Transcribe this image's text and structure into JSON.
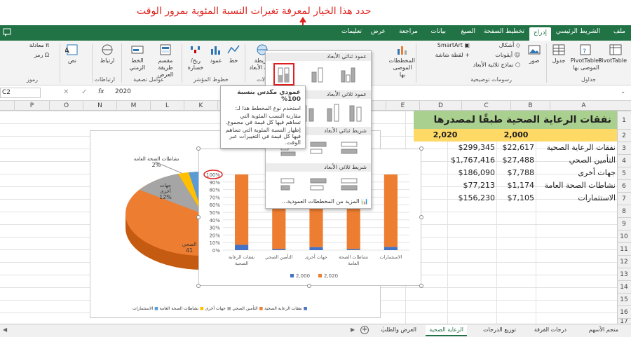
{
  "annotation": "حدد هذا الخيار لمعرفة تغيرات النسبة المئوية بمرور الوقت",
  "tabs": [
    "ملف",
    "الشريط الرئيسي",
    "إدراج",
    "تخطيط الصفحة",
    "الصيغ",
    "بيانات",
    "مراجعة",
    "عرض",
    "تعليمات"
  ],
  "active_tab": "إدراج",
  "ribbon": {
    "pivottable": "PivotTable",
    "recommended_pivot": "PivotTables الموصى بها",
    "table": "جدول",
    "pictures": "صور",
    "shapes": "أشكال",
    "icons": "أيقونات",
    "models3d": "نماذج ثلاثية الأبعاد",
    "smartart": "SmartArt",
    "screenshot": "لقطة شاشة",
    "recommended_charts": "المخططات الموصى بها",
    "map3d": "خريطة ثلاثية الأبعاد",
    "line": "خط",
    "column": "عمود",
    "winloss": "ربح/ خسارة",
    "slicer": "مقسم طريقة العرض",
    "timeline": "الخط الزمني",
    "link": "ارتباط",
    "text": "نص",
    "equation": "معادلة",
    "symbol": "رمز",
    "groups": {
      "tables": "جداول",
      "illustrations": "رسومات توضيحية",
      "tours": "الجولات",
      "sparklines": "خطوط المؤشر",
      "filters": "عوامل تصفية",
      "links": "ارتباطات",
      "symbols": "رموز"
    }
  },
  "formula_bar": {
    "name_box": "C2",
    "fx": "fx",
    "value": "2020"
  },
  "columns": [
    "A",
    "B",
    "C",
    "D",
    "E",
    "F",
    "G",
    "H",
    "I",
    "J",
    "K",
    "L",
    "M",
    "N",
    "O",
    "P"
  ],
  "rows": [
    "1",
    "2",
    "3",
    "4",
    "5",
    "6",
    "7",
    "8",
    "9",
    "10",
    "11",
    "12",
    "13",
    "14",
    "15",
    "16",
    "17"
  ],
  "table": {
    "title": "نفقات الرعاية الصحية طبقًا لمصدرها",
    "header": [
      "2,000",
      "2,020"
    ],
    "rows": [
      {
        "label": "نفقات الرعاية الصحية",
        "b": "$22,617",
        "c": "$299,345"
      },
      {
        "label": "التأمين الصحي",
        "b": "$27,488",
        "c": "$1,767,416"
      },
      {
        "label": "جهات أخرى",
        "b": "$7,788",
        "c": "$186,090"
      },
      {
        "label": "نشاطات الصحة العامة",
        "b": "$1,174",
        "c": "$77,213"
      },
      {
        "label": "الاستثمارات",
        "b": "$7,105",
        "c": "$156,230"
      }
    ]
  },
  "dropdown": {
    "h2d_col": "عمود ثنائي الأبعاد",
    "h3d_col": "عمود ثلاثي الأبعاد",
    "h2d_bar": "شريط ثنائي الأبعاد",
    "h3d_bar": "شريط ثلاثي الأبعاد",
    "more": "المزيد من المخططات العمودية..."
  },
  "tooltip": {
    "title": "عمودي مكدس بنسبة 100%",
    "body": "استخدم نوع المخطط هذا لـ:",
    "b1": "مقارنة النسب المئوية التي تساهم فيها كل قيمة في مجموع.",
    "b2": "إظهار النسبة المئوية التي تساهم فيها كل قيمة في التغييرات عبر الوقت."
  },
  "pie_labels": {
    "l1": "نشاطات الصحة العامة",
    "l1v": "2%",
    "l2": "جهات أخرى",
    "l2v": "12%",
    "l3": "الصحي",
    "l3v": "41"
  },
  "pie_legend": [
    "نفقات الرعاية الصحية",
    "التأمين الصحي",
    "جهات أخرى",
    "نشاطات الصحة العامة",
    "الاستثمارات"
  ],
  "chart_data": [
    {
      "type": "bar",
      "stacked": "100%",
      "categories": [
        "نفقات الرعاية الصحية",
        "التأمين الصحي",
        "جهات أخرى",
        "نشاطات الصحة العامة",
        "الاستثمارات"
      ],
      "series": [
        {
          "name": "2,000",
          "values": [
            22617,
            27488,
            7788,
            1174,
            7105
          ],
          "color": "#4472c4"
        },
        {
          "name": "2,020",
          "values": [
            299345,
            1767416,
            186090,
            77213,
            156230
          ],
          "color": "#ed7d31"
        }
      ],
      "yticks": [
        "0%",
        "10%",
        "20%",
        "30%",
        "40%",
        "50%",
        "60%",
        "70%",
        "80%",
        "90%",
        "100%"
      ],
      "ylim": [
        0,
        100
      ]
    }
  ],
  "sheet_tabs": [
    "منجم الأسهم",
    "درجات الفرقة",
    "توزيع الدرجات",
    "الرعاية الصحية",
    "العرض والطلب"
  ],
  "active_sheet": "الرعاية الصحية",
  "colors": {
    "excel_green": "#217346",
    "annotation_red": "#e0201b",
    "header_green": "#a9d08e",
    "header_row": "#ffd966"
  }
}
